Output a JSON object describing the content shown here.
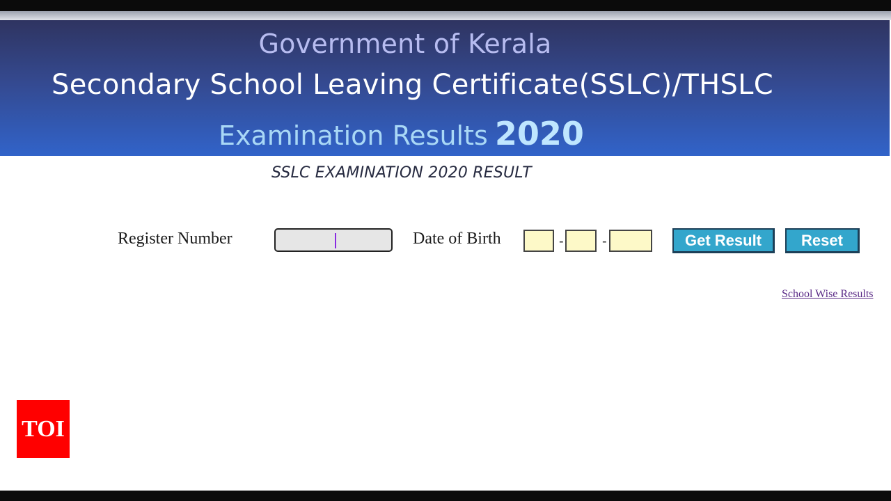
{
  "header": {
    "line1": "Government of Kerala",
    "line2": "Secondary School Leaving Certificate(SSLC)/THSLC",
    "line3": "Examination Results",
    "year": "2020"
  },
  "subtitle": "SSLC EXAMINATION 2020 RESULT",
  "form": {
    "register_label": "Register Number",
    "register_value": "",
    "dob_label": "Date of Birth",
    "dob_day": "",
    "dob_month": "",
    "dob_year": "",
    "separator": "-",
    "get_result_label": "Get Result",
    "reset_label": "Reset"
  },
  "links": {
    "school_wise": "School Wise Results"
  },
  "watermark": {
    "text": "TOI"
  },
  "colors": {
    "header_top": "#2f3461",
    "header_bottom": "#3163c9",
    "button": "#33a6cc",
    "dob_field": "#fdf9c8",
    "watermark": "#ff0000"
  }
}
